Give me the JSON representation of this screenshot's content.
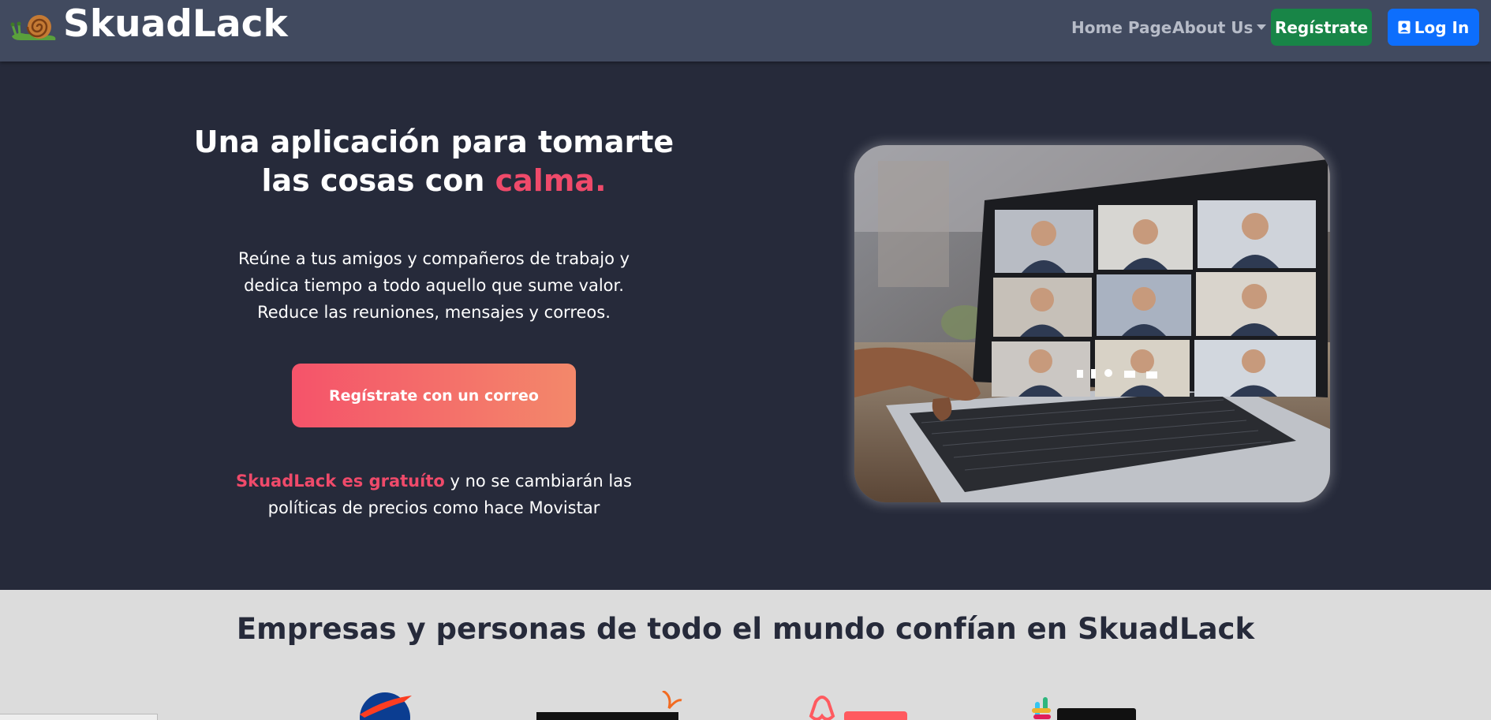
{
  "navbar": {
    "brand": "SkuadLack",
    "home_label": "Home Page",
    "about_label": "About Us",
    "register_label": "Regístrate",
    "login_label": "Log In",
    "login_icon": "person-badge-icon",
    "colors": {
      "background": "#414a5f",
      "register": "#188547",
      "login": "#0d6efd"
    }
  },
  "hero": {
    "title_main": "Una aplicación para tomarte las cosas con ",
    "title_accent": "calma.",
    "description": "Reúne a tus amigos y compañeros de trabajo y dedica tiempo a todo aquello que sume valor. Reduce las reuniones, mensajes y correos.",
    "cta_label": "Regístrate con un correo",
    "free_accent": "SkuadLack es gratuíto",
    "free_rest": " y no se cambiarán las políticas de precios como hace Movistar",
    "image": "laptop-video-call-photo",
    "colors": {
      "background": "#262a3a",
      "accent": "#ef4a6a",
      "cta_start": "#f5536a",
      "cta_end": "#f3886a"
    }
  },
  "trust": {
    "title": "Empresas y personas de todo el mundo confían en SkuadLack",
    "logos": [
      "nasa-logo",
      "mundo-today-logo",
      "airbnb-logo",
      "slack-logo"
    ],
    "background": "#dcdcdc"
  }
}
